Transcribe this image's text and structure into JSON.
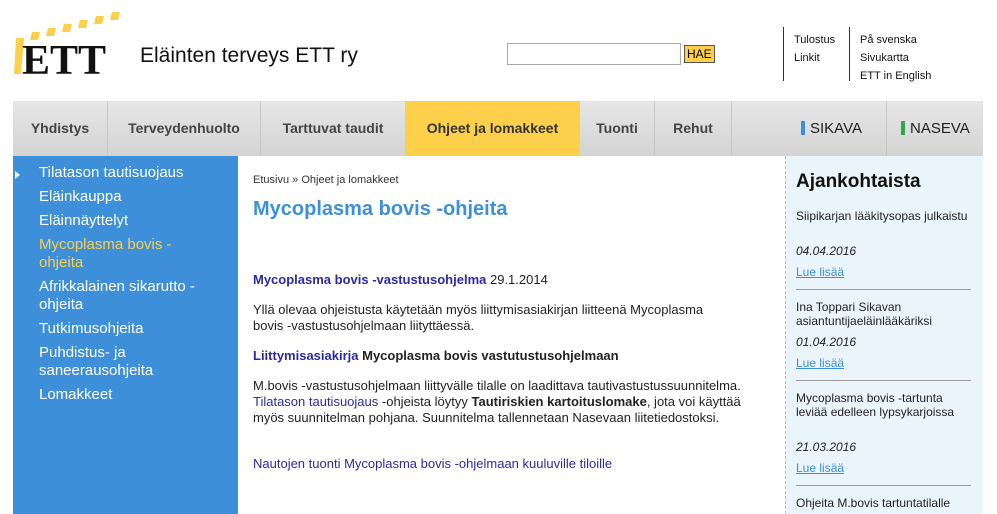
{
  "header": {
    "logo_text": "ETT",
    "site_title": "Eläinten terveys ETT ry",
    "search": {
      "value": "",
      "placeholder": "",
      "button_label": "HAE"
    },
    "utility_links_left": [
      "Tulostus",
      "Linkit"
    ],
    "utility_links_right": [
      "På svenska",
      "Sivukartta",
      "ETT in English"
    ]
  },
  "nav": {
    "items": [
      {
        "label": "Yhdistys"
      },
      {
        "label": "Terveydenhuolto"
      },
      {
        "label": "Tarttuvat taudit"
      },
      {
        "label": "Ohjeet ja lomakkeet",
        "active": true
      },
      {
        "label": "Tuonti"
      },
      {
        "label": "Rehut"
      }
    ],
    "partners": [
      {
        "label": "SIKAVA",
        "color": "#3d8fd9"
      },
      {
        "label": "NASEVA",
        "color": "#2aa84a"
      }
    ]
  },
  "sidebar": {
    "items": [
      {
        "label": "Tilatason tautisuojaus"
      },
      {
        "label": "Eläinkauppa"
      },
      {
        "label": "Eläinnäyttelyt"
      },
      {
        "label": "Mycoplasma bovis -ohjeita",
        "current": true
      },
      {
        "label": "Afrikkalainen sikarutto -ohjeita"
      },
      {
        "label": "Tutkimusohjeita"
      },
      {
        "label": "Puhdistus- ja saneerausohjeita"
      },
      {
        "label": "Lomakkeet"
      }
    ]
  },
  "main": {
    "breadcrumb": {
      "home": "Etusivu",
      "separator": "»",
      "current": "Ohjeet ja lomakkeet"
    },
    "title": "Mycoplasma bovis -ohjeita",
    "section1": {
      "link": "Mycoplasma bovis -vastustusohjelma",
      "date": "29.1.2014"
    },
    "para1": "Yllä olevaa ohjeistusta käytetään myös liittymisasiakirjan liitteenä Mycoplasma bovis -vastustusohjelmaan liityttäessä.",
    "section2": {
      "link": "Liittymisasiakirja",
      "text": "Mycoplasma bovis vastutustusohjelmaan"
    },
    "para2": {
      "before": "M.bovis -vastustusohjelmaan liittyvälle tilalle on laadittava tautivastustussuunnitelma.",
      "link": "Tilatason tautisuojaus",
      "middle": "-ohjeista löytyy",
      "bold": "Tautiriskien kartoituslomake",
      "after": ", jota voi käyttää myös suunnitelman pohjana. Suunnitelma tallennetaan Nasevaan liitetiedostoksi."
    },
    "link3": "Nautojen tuonti Mycoplasma bovis -ohjelmaan kuuluville tiloille"
  },
  "news": {
    "title": "Ajankohtaista",
    "more_label": "Lue lisää",
    "items": [
      {
        "title": "Siipikarjan lääkitysopas julkaistu",
        "date": "04.04.2016"
      },
      {
        "title": "Ina Toppari Sikavan asiantuntijaeläinlääkäriksi",
        "date": "01.04.2016"
      },
      {
        "title": "Mycoplasma bovis -tartunta leviää edelleen lypsykarjoissa",
        "date": "21.03.2016"
      },
      {
        "title": "Ohjeita M.bovis tartuntatilalle",
        "date": ""
      }
    ]
  }
}
